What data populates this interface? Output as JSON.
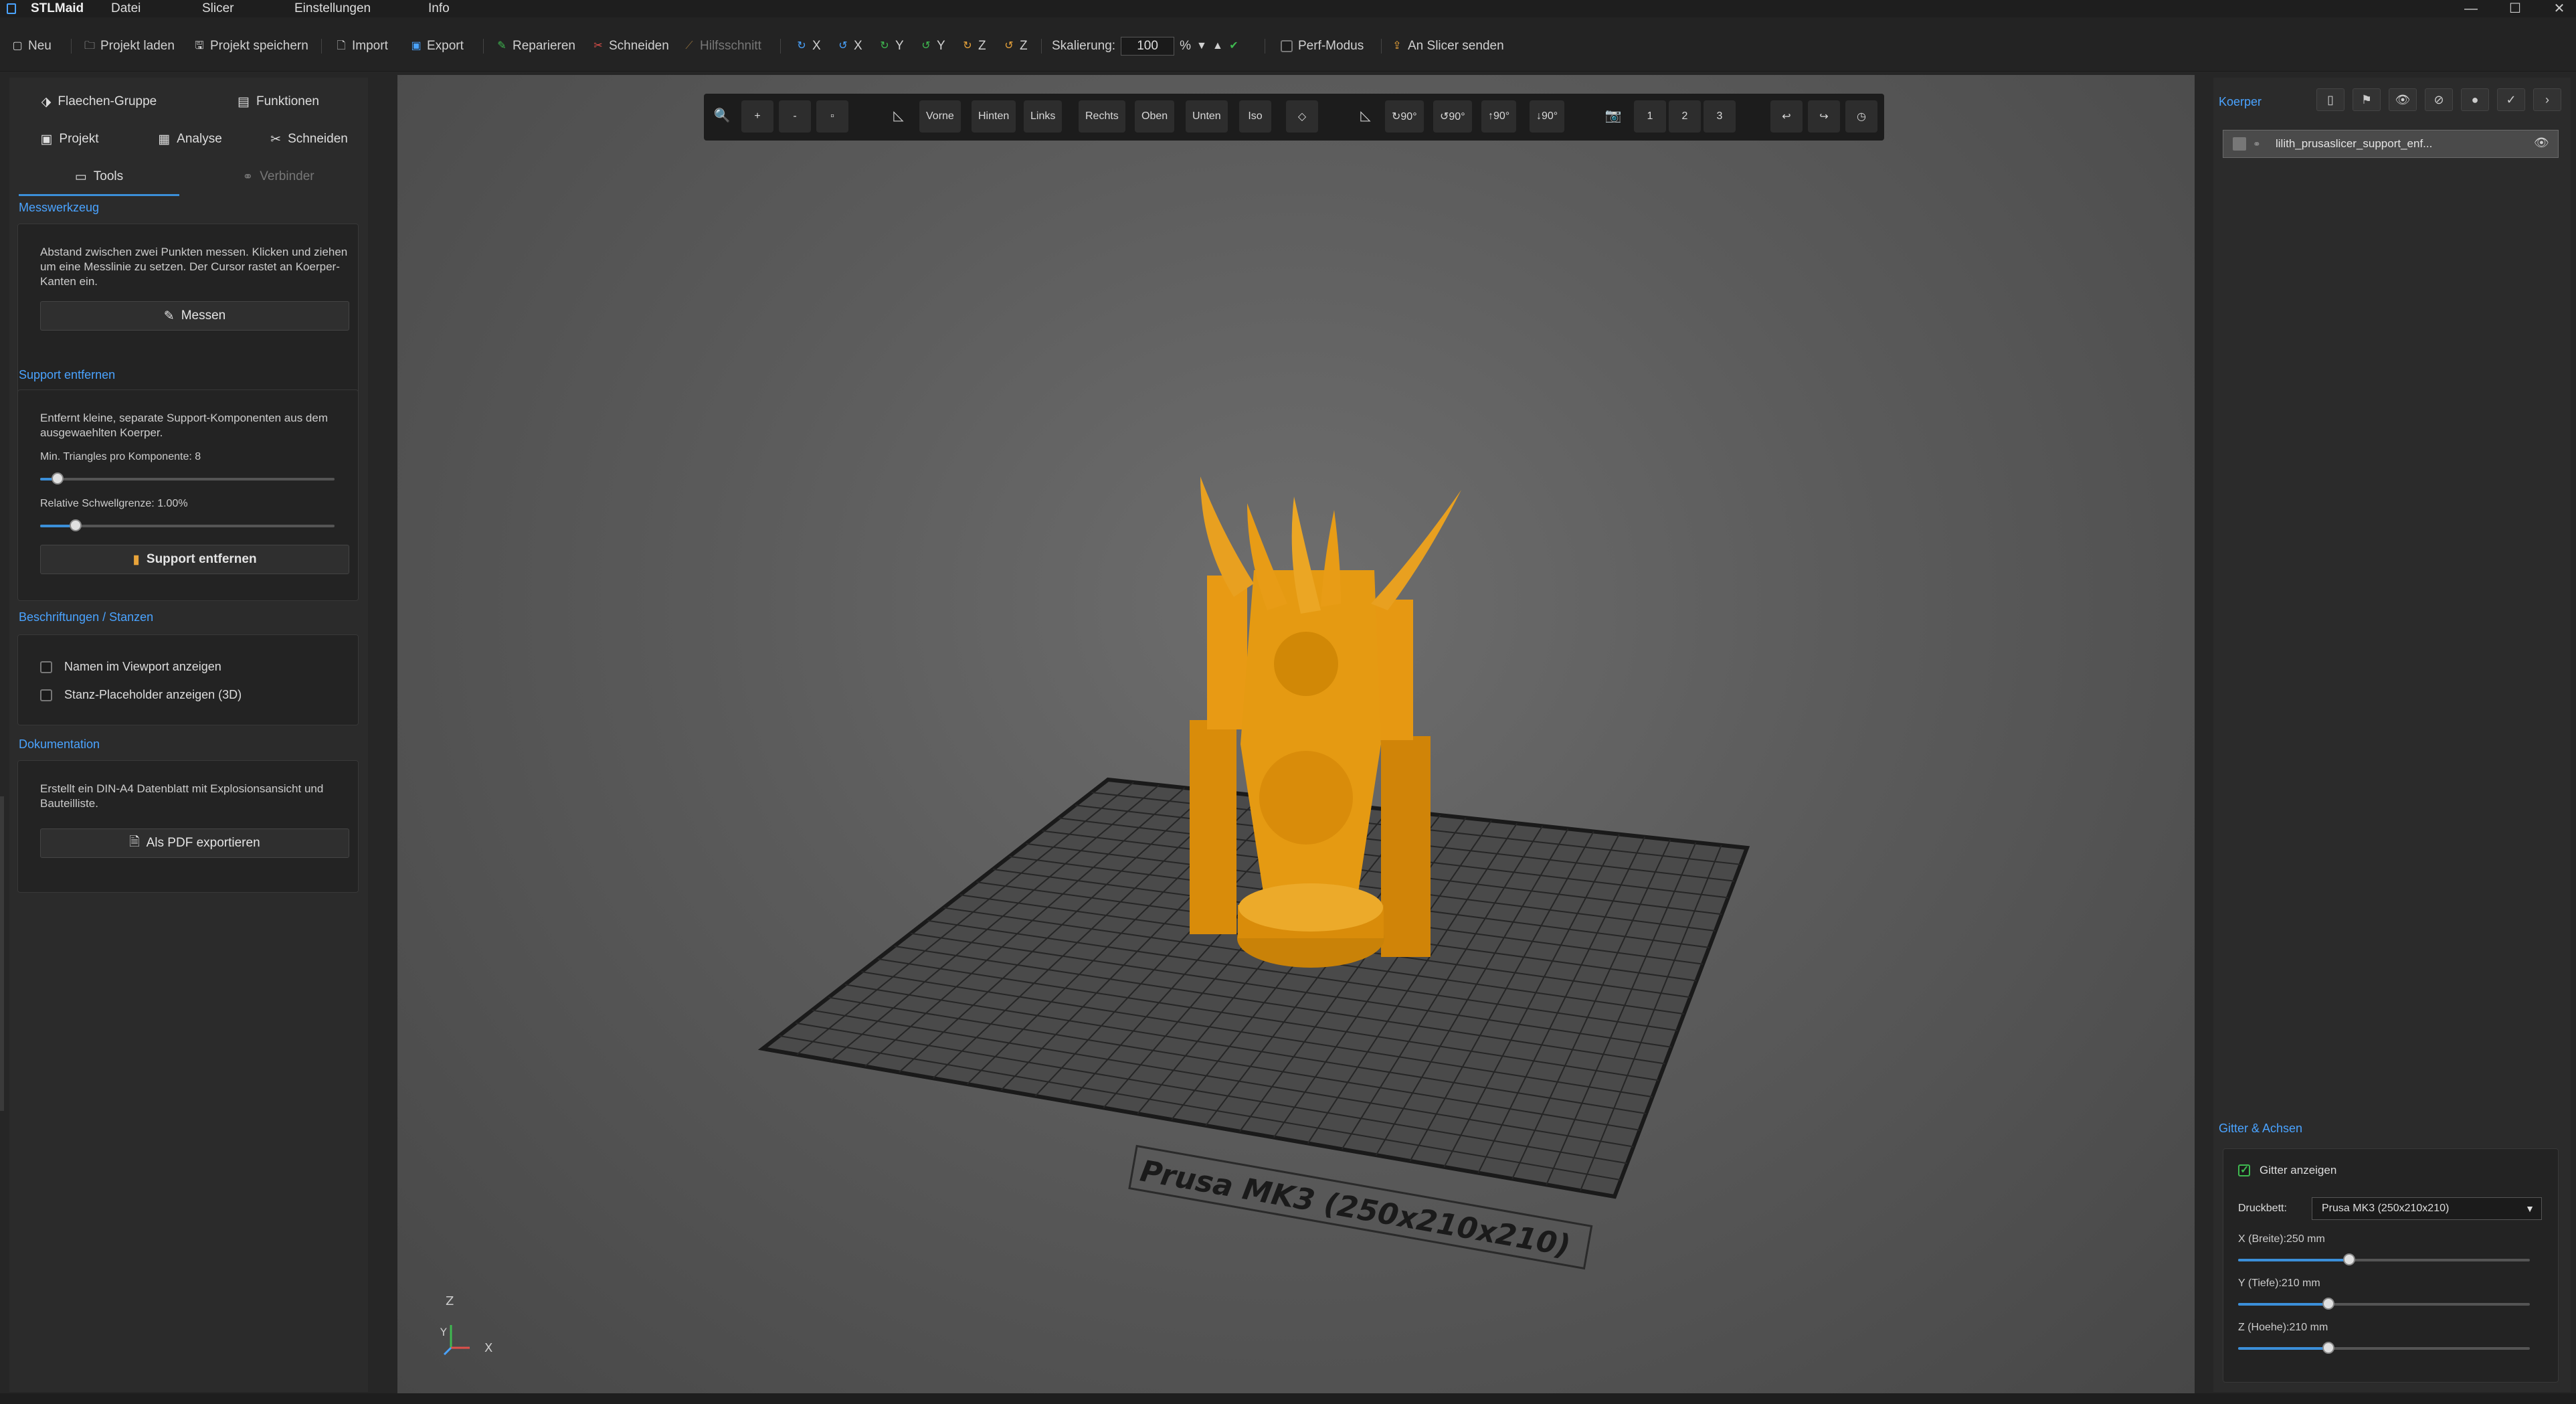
{
  "app": {
    "name": "STLMaid",
    "menu": [
      "Datei",
      "Slicer",
      "Einstellungen",
      "Info"
    ],
    "window_controls": [
      "minimize",
      "maximize",
      "close"
    ]
  },
  "toolbar": {
    "new": "Neu",
    "load_project": "Projekt laden",
    "save_project": "Projekt speichern",
    "import": "Import",
    "export": "Export",
    "repair": "Reparieren",
    "cut": "Schneiden",
    "helper_cut": "Hilfsschnitt",
    "rotations": [
      {
        "label": "X",
        "color": "#4aa3ff"
      },
      {
        "label": "X",
        "color": "#4aa3ff"
      },
      {
        "label": "Y",
        "color": "#3fb950"
      },
      {
        "label": "Y",
        "color": "#3fb950"
      },
      {
        "label": "Z",
        "color": "#e8a33a"
      },
      {
        "label": "Z",
        "color": "#e8a33a"
      }
    ],
    "scale_label": "Skalierung:",
    "scale_value": "100",
    "scale_unit": "%",
    "perf_mode": "Perf-Modus",
    "send_to_slicer": "An Slicer senden"
  },
  "left_panel": {
    "tabs_row1": [
      "Flaechen-Gruppe",
      "Funktionen"
    ],
    "tabs_row2": [
      "Projekt",
      "Analyse",
      "Schneiden"
    ],
    "tabs_row3": [
      "Tools",
      "Verbinder"
    ],
    "measure": {
      "title": "Messwerkzeug",
      "text": "Abstand zwischen zwei Punkten messen. Klicken und ziehen um eine Messlinie zu setzen. Der Cursor rastet an Koerper-Kanten ein.",
      "button": "Messen"
    },
    "support": {
      "title": "Support entfernen",
      "text": "Entfernt kleine, separate Support-Komponenten aus dem ausgewaehlten Koerper.",
      "min_tri_label": "Min. Triangles pro Komponente: 8",
      "min_tri_value": 0.06,
      "rel_label": "Relative Schwellgrenze: 1.00%",
      "rel_value": 0.12,
      "button": "Support entfernen"
    },
    "labels": {
      "title": "Beschriftungen / Stanzen",
      "show_names": "Namen im Viewport anzeigen",
      "show_placeholder": "Stanz-Placeholder anzeigen (3D)"
    },
    "docs": {
      "title": "Dokumentation",
      "text": "Erstellt ein DIN-A4 Datenblatt mit Explosionsansicht und Bauteilliste.",
      "button": "Als PDF exportieren"
    }
  },
  "view_toolbar": {
    "zoom": [
      "+",
      "-",
      "▫"
    ],
    "views": [
      "Vorne",
      "Hinten",
      "Links",
      "Rechts",
      "Oben",
      "Unten",
      "Iso",
      "◇"
    ],
    "rotate": [
      "↻90°",
      "↺90°",
      "↑90°",
      "↓90°"
    ],
    "cams": [
      "1",
      "2",
      "3"
    ]
  },
  "viewport": {
    "bed_label": "Prusa MK3 (250x210x210)",
    "axis_labels": [
      "Z",
      "Y",
      "X"
    ],
    "model_color": "#e59a12"
  },
  "right_panel": {
    "title": "Koerper",
    "body_name": "lilith_prusaslicer_support_enf...",
    "grid": {
      "title": "Gitter & Achsen",
      "show_grid": "Gitter anzeigen",
      "bed_label": "Druckbett:",
      "bed_value": "Prusa MK3 (250x210x210)",
      "x_label": "X (Breite):250 mm",
      "x_value": 0.38,
      "y_label": "Y (Tiefe):210 mm",
      "y_value": 0.31,
      "z_label": "Z (Hoehe):210 mm",
      "z_value": 0.31
    }
  }
}
